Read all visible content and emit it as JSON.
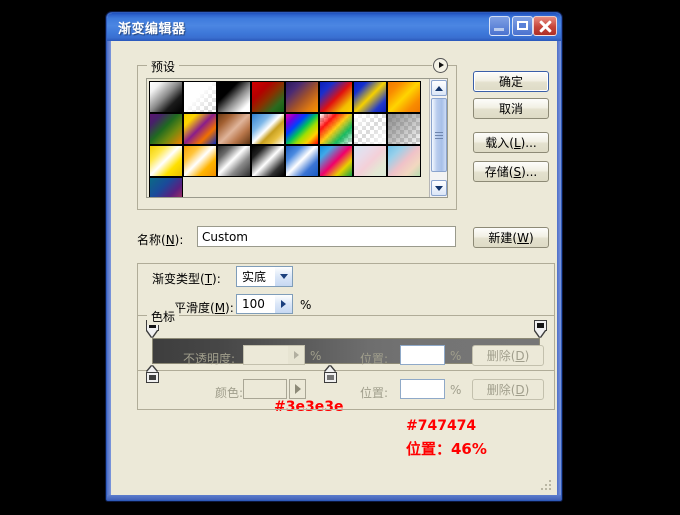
{
  "window": {
    "title": "渐变编辑器",
    "buttons": {
      "minimize": "minimize-icon",
      "maximize": "maximize-icon",
      "close": "close-icon"
    }
  },
  "presets": {
    "group_label": "预设",
    "menu_icon": "preset-menu-arrow-icon",
    "scrollbar": {
      "up": "scroll-up-icon",
      "down": "scroll-down-icon"
    },
    "swatches": [
      {
        "name": "foreground-to-background",
        "css": "linear-gradient(135deg,#ffffff 0%,#f2f2f2 18%,#8a8a8a 48%,#1a1a1a 72%,#000000 100%)"
      },
      {
        "name": "foreground-to-transparent",
        "css": "linear-gradient(135deg,#ffffff 0%,#ffffff 42%,rgba(255,255,255,0) 100%)",
        "checker": true
      },
      {
        "name": "black-to-white",
        "css": "linear-gradient(135deg,#000000 0%,#000000 32%,#8c8c8c 58%,#ffffff 85%,#ffffff 100%)"
      },
      {
        "name": "red-to-green",
        "css": "linear-gradient(135deg,#d20000 0%,#b40000 30%,#8a3000 52%,#2c6a1e 78%,#0f5e14 100%)"
      },
      {
        "name": "violet-to-orange",
        "css": "linear-gradient(135deg,#2b1a5e 0%,#4a2a74 25%,#a2522a 55%,#e07b10 80%,#f79500 100%)"
      },
      {
        "name": "blue-red-yellow",
        "css": "linear-gradient(135deg,#0b1fb8 0%,#1b2fcc 22%,#e01010 52%,#f2c000 80%,#ffd400 100%)"
      },
      {
        "name": "blue-yellow-blue",
        "css": "linear-gradient(135deg,#0a1fc0 0%,#1430d0 20%,#f5d000 50%,#2038cc 80%,#0a1fb8 100%)"
      },
      {
        "name": "orange-yellow-orange",
        "css": "linear-gradient(135deg,#f07800 0%,#f98c00 22%,#ffd400 50%,#f98c00 78%,#f07800 100%)"
      },
      {
        "name": "violet-green-orange",
        "css": "linear-gradient(135deg,#5c1470 0%,#47206a 18%,#1f6a20 45%,#6f8a10 68%,#f08000 100%)"
      },
      {
        "name": "yellow-violet-orange-blue",
        "css": "linear-gradient(135deg,#f5d000 0%,#ffd400 20%,#8a1d8a 48%,#f07000 72%,#1030b8 100%)"
      },
      {
        "name": "copper",
        "css": "linear-gradient(135deg,#6b3a14 0%,#a36032 22%,#e0b49a 50%,#b8764a 72%,#5e3412 100%)"
      },
      {
        "name": "chrome",
        "css": "linear-gradient(135deg,#2f7fd0 0%,#7fb8e8 30%,#ffffff 48%,#c8a020 62%,#e8c040 78%,#ffffff 100%)"
      },
      {
        "name": "spectrum",
        "css": "linear-gradient(135deg,#f000a0 0%,#7000e0 18%,#0040ff 34%,#00c060 50%,#a0e000 64%,#ffd000 80%,#ff0000 100%)"
      },
      {
        "name": "transparent-rainbow",
        "css": "linear-gradient(135deg,rgba(240,0,160,0) 0%,rgba(255,0,0,0.9) 26%,rgba(255,200,0,0.9) 48%,rgba(0,180,80,0.9) 72%,rgba(0,120,200,0) 100%)",
        "checker": true
      },
      {
        "name": "transparent-stripes",
        "css": "linear-gradient(135deg,rgba(255,255,255,0.95) 0%,rgba(255,255,255,0.2) 50%,rgba(255,255,255,0.95) 100%)",
        "checker": true
      },
      {
        "name": "neutral-density",
        "css": "linear-gradient(135deg,rgba(120,120,120,0.85) 0%,rgba(140,140,140,0.5) 55%,rgba(160,160,160,0.05) 100%)",
        "checker": true
      },
      {
        "name": "yellow-white-gradient",
        "css": "linear-gradient(135deg,#f2d000 0%,#ffe84a 25%,#ffffff 48%,#ffe000 72%,#e8c000 100%)"
      },
      {
        "name": "orange-white-gradient",
        "css": "linear-gradient(135deg,#f5a000 0%,#ffc43a 25%,#ffffff 48%,#ffb400 72%,#f09000 100%)"
      },
      {
        "name": "silver-gradient",
        "css": "linear-gradient(135deg,#2a2a2a 0%,#6a6a6a 22%,#ffffff 46%,#8a8a8a 68%,#303030 100%)"
      },
      {
        "name": "black-white-black",
        "css": "linear-gradient(135deg,#000000 0%,#202020 20%,#ffffff 50%,#303030 78%,#000000 100%)"
      },
      {
        "name": "blue-white-blue",
        "css": "linear-gradient(135deg,#1a5ac0 0%,#4a8ae0 25%,#ffffff 48%,#3a74d4 74%,#1a5ac0 100%)"
      },
      {
        "name": "blue-pink-green",
        "css": "linear-gradient(135deg,#1090e0 0%,#40a8e8 20%,#f0006a 50%,#e8d000 74%,#10a048 100%)"
      },
      {
        "name": "pastel-pink",
        "css": "linear-gradient(135deg,#d6e8f2 0%,#e8dcea 28%,#f4d0d8 52%,#e4e8d4 78%,#dbead8 100%)"
      },
      {
        "name": "pastel-blue-pink",
        "css": "linear-gradient(135deg,#6cc0e8 0%,#9ad0ea 24%,#f0c2c8 52%,#f2d8c0 76%,#b8dcb0 100%)"
      },
      {
        "name": "teal-violet",
        "css": "linear-gradient(135deg,#0a6a86 0%,#1a4a9a 35%,#5a2080 62%,#a03060 85%,#6a8a20 100%)"
      }
    ]
  },
  "name_row": {
    "label": "名称(N):",
    "label_plain": "名称",
    "label_accel": "N",
    "value": "Custom",
    "new_button": "新建(W)"
  },
  "action_buttons": {
    "ok": "确定",
    "cancel": "取消",
    "load": "载入(L)...",
    "save": "存储(S)..."
  },
  "gradient_type": {
    "label": "渐变类型(T):",
    "value": "实底",
    "dropdown_icon": "chevron-down-icon"
  },
  "smoothness": {
    "label": "平滑度(M):",
    "value": "100",
    "unit": "%",
    "stepper_icon": "stepper-arrow-icon"
  },
  "gradient_bar": {
    "css": "linear-gradient(to right,#3e3e3e 0%,#474747 18%,#5c5c5c 40%,#6e6e6e 56%,#747474 70%,#767676 100%)",
    "opacity_stops": [
      {
        "name": "opacity-stop-left",
        "position_pct": 0
      },
      {
        "name": "opacity-stop-right",
        "position_pct": 100
      }
    ],
    "color_stops": [
      {
        "name": "color-stop-left",
        "position_pct": 0,
        "color": "#3e3e3e"
      },
      {
        "name": "color-stop-middle",
        "position_pct": 46,
        "color": "#747474"
      }
    ]
  },
  "annotations": {
    "left_color": "#3e3e3e",
    "mid_color": "#747474",
    "position": "位置：46%",
    "color_hex": "#ff0000"
  },
  "color_stops_panel": {
    "group_label": "色标",
    "opacity_label": "不透明度:",
    "opacity_value": "",
    "opacity_unit": "%",
    "position1_label": "位置:",
    "position1_value": "",
    "position1_unit": "%",
    "delete1": "删除(D)",
    "color_label": "颜色:",
    "color_value": "",
    "position2_label": "位置:",
    "position2_value": "",
    "position2_unit": "%",
    "delete2": "删除(D)"
  },
  "resize_grip": "resize-grip-icon"
}
